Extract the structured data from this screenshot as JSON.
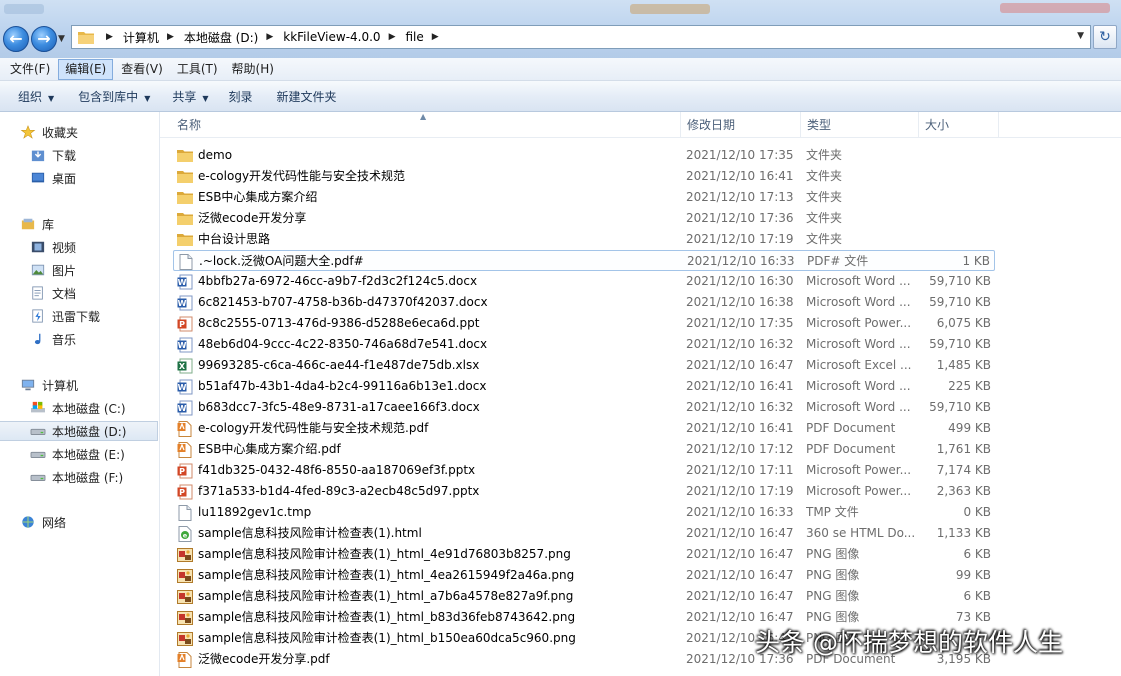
{
  "address_bar": {
    "breadcrumbs": [
      "计算机",
      "本地磁盘 (D:)",
      "kkFileView-4.0.0",
      "file"
    ]
  },
  "menu": {
    "items": [
      "文件(F)",
      "编辑(E)",
      "查看(V)",
      "工具(T)",
      "帮助(H)"
    ],
    "active_index": 1
  },
  "toolbar": {
    "organize": "组织",
    "include_in_library": "包含到库中",
    "share": "共享",
    "burn": "刻录",
    "new_folder": "新建文件夹"
  },
  "nav_pane": {
    "favorites": {
      "label": "收藏夹",
      "items": [
        "下载",
        "桌面"
      ]
    },
    "libraries": {
      "label": "库",
      "items": [
        "视频",
        "图片",
        "文档",
        "迅雷下载",
        "音乐"
      ]
    },
    "computer": {
      "label": "计算机",
      "items": [
        "本地磁盘 (C:)",
        "本地磁盘 (D:)",
        "本地磁盘 (E:)",
        "本地磁盘 (F:)"
      ],
      "selected": "本地磁盘 (D:)"
    },
    "network": {
      "label": "网络"
    }
  },
  "columns": {
    "name": "名称",
    "date": "修改日期",
    "type": "类型",
    "size": "大小"
  },
  "files": [
    {
      "name": "demo",
      "date": "2021/12/10 17:35",
      "type": "文件夹",
      "size": "",
      "icon": "folder-icon"
    },
    {
      "name": "e-cology开发代码性能与安全技术规范",
      "date": "2021/12/10 16:41",
      "type": "文件夹",
      "size": "",
      "icon": "folder-icon"
    },
    {
      "name": "ESB中心集成方案介绍",
      "date": "2021/12/10 17:13",
      "type": "文件夹",
      "size": "",
      "icon": "folder-icon"
    },
    {
      "name": "泛微ecode开发分享",
      "date": "2021/12/10 17:36",
      "type": "文件夹",
      "size": "",
      "icon": "folder-icon"
    },
    {
      "name": "中台设计思路",
      "date": "2021/12/10 17:19",
      "type": "文件夹",
      "size": "",
      "icon": "folder-icon"
    },
    {
      "name": ".~lock.泛微OA问题大全.pdf#",
      "date": "2021/12/10 16:33",
      "type": "PDF# 文件",
      "size": "1 KB",
      "icon": "blank-file-icon"
    },
    {
      "name": "4bbfb27a-6972-46cc-a9b7-f2d3c2f124c5.docx",
      "date": "2021/12/10 16:30",
      "type": "Microsoft Word ...",
      "size": "59,710 KB",
      "icon": "word-icon"
    },
    {
      "name": "6c821453-b707-4758-b36b-d47370f42037.docx",
      "date": "2021/12/10 16:38",
      "type": "Microsoft Word ...",
      "size": "59,710 KB",
      "icon": "word-icon"
    },
    {
      "name": "8c8c2555-0713-476d-9386-d5288e6eca6d.ppt",
      "date": "2021/12/10 17:35",
      "type": "Microsoft Power...",
      "size": "6,075 KB",
      "icon": "ppt-icon"
    },
    {
      "name": "48eb6d04-9ccc-4c22-8350-746a68d7e541.docx",
      "date": "2021/12/10 16:32",
      "type": "Microsoft Word ...",
      "size": "59,710 KB",
      "icon": "word-icon"
    },
    {
      "name": "99693285-c6ca-466c-ae44-f1e487de75db.xlsx",
      "date": "2021/12/10 16:47",
      "type": "Microsoft Excel ...",
      "size": "1,485 KB",
      "icon": "excel-icon"
    },
    {
      "name": "b51af47b-43b1-4da4-b2c4-99116a6b13e1.docx",
      "date": "2021/12/10 16:41",
      "type": "Microsoft Word ...",
      "size": "225 KB",
      "icon": "word-icon"
    },
    {
      "name": "b683dcc7-3fc5-48e9-8731-a17caee166f3.docx",
      "date": "2021/12/10 16:32",
      "type": "Microsoft Word ...",
      "size": "59,710 KB",
      "icon": "word-icon"
    },
    {
      "name": "e-cology开发代码性能与安全技术规范.pdf",
      "date": "2021/12/10 16:41",
      "type": "PDF Document",
      "size": "499 KB",
      "icon": "pdf-icon"
    },
    {
      "name": "ESB中心集成方案介绍.pdf",
      "date": "2021/12/10 17:12",
      "type": "PDF Document",
      "size": "1,761 KB",
      "icon": "pdf-icon"
    },
    {
      "name": "f41db325-0432-48f6-8550-aa187069ef3f.pptx",
      "date": "2021/12/10 17:11",
      "type": "Microsoft Power...",
      "size": "7,174 KB",
      "icon": "ppt-icon"
    },
    {
      "name": "f371a533-b1d4-4fed-89c3-a2ecb48c5d97.pptx",
      "date": "2021/12/10 17:19",
      "type": "Microsoft Power...",
      "size": "2,363 KB",
      "icon": "ppt-icon"
    },
    {
      "name": "lu11892gev1c.tmp",
      "date": "2021/12/10 16:33",
      "type": "TMP 文件",
      "size": "0 KB",
      "icon": "blank-file-icon"
    },
    {
      "name": "sample信息科技风险审计检查表(1).html",
      "date": "2021/12/10 16:47",
      "type": "360 se HTML Do...",
      "size": "1,133 KB",
      "icon": "html-icon"
    },
    {
      "name": "sample信息科技风险审计检查表(1)_html_4e91d76803b8257.png",
      "date": "2021/12/10 16:47",
      "type": "PNG 图像",
      "size": "6 KB",
      "icon": "image-icon"
    },
    {
      "name": "sample信息科技风险审计检查表(1)_html_4ea2615949f2a46a.png",
      "date": "2021/12/10 16:47",
      "type": "PNG 图像",
      "size": "99 KB",
      "icon": "image-icon"
    },
    {
      "name": "sample信息科技风险审计检查表(1)_html_a7b6a4578e827a9f.png",
      "date": "2021/12/10 16:47",
      "type": "PNG 图像",
      "size": "6 KB",
      "icon": "image-icon"
    },
    {
      "name": "sample信息科技风险审计检查表(1)_html_b83d36feb8743642.png",
      "date": "2021/12/10 16:47",
      "type": "PNG 图像",
      "size": "73 KB",
      "icon": "image-icon"
    },
    {
      "name": "sample信息科技风险审计检查表(1)_html_b150ea60dca5c960.png",
      "date": "2021/12/10 16:47",
      "type": "PNG 图像",
      "size": "",
      "icon": "image-icon"
    },
    {
      "name": "泛微ecode开发分享.pdf",
      "date": "2021/12/10 17:36",
      "type": "PDF Document",
      "size": "3,195 KB",
      "icon": "pdf-icon"
    }
  ],
  "focused_file_index": 5,
  "watermark": "头条 @怀揣梦想的软件人生"
}
